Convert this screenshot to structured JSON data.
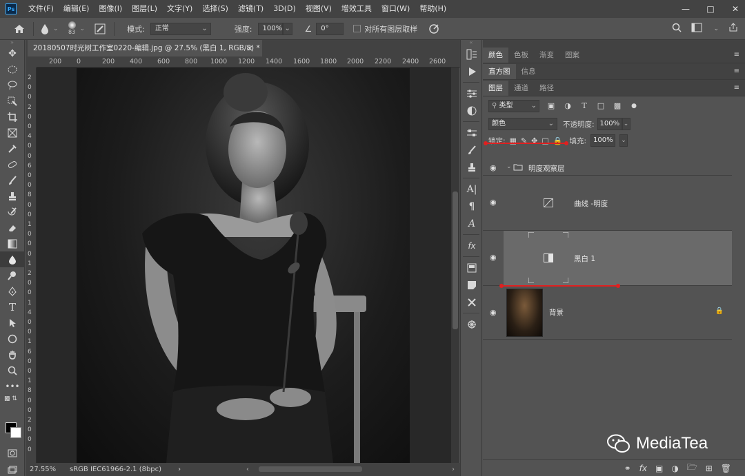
{
  "menubar": {
    "logo": "Ps",
    "items": [
      "文件(F)",
      "编辑(E)",
      "图像(I)",
      "图层(L)",
      "文字(Y)",
      "选择(S)",
      "滤镜(T)",
      "3D(D)",
      "视图(V)",
      "增效工具",
      "窗口(W)",
      "帮助(H)"
    ]
  },
  "options": {
    "brush_size": "83",
    "mode_label": "模式:",
    "mode_value": "正常",
    "strength_label": "强度:",
    "strength_value": "100%",
    "angle_value": "0°",
    "sample_all_label": "对所有图层取样"
  },
  "document": {
    "tab_title": "20180507时光树工作室0220-编辑.jpg @ 27.5% (黑白 1, RGB/8) *",
    "ruler_h": [
      "200",
      "0",
      "200",
      "400",
      "600",
      "800",
      "1000",
      "1200",
      "1400",
      "1600",
      "1800",
      "2000",
      "2200",
      "2400",
      "2600"
    ],
    "ruler_v": [
      "2",
      "0",
      "0",
      "2",
      "0",
      "0",
      "4",
      "0",
      "0",
      "6",
      "0",
      "0",
      "8",
      "0",
      "0",
      "1",
      "0",
      "0",
      "0",
      "1",
      "2",
      "0",
      "0",
      "1",
      "4",
      "0",
      "0",
      "1",
      "6",
      "0",
      "0",
      "1",
      "8",
      "0",
      "0",
      "2",
      "0",
      "0",
      "0"
    ],
    "zoom": "27.55%",
    "color_profile": "sRGB IEC61966-2.1 (8bpc)"
  },
  "panels": {
    "group1_tabs": [
      "颜色",
      "色板",
      "渐变",
      "图案"
    ],
    "group2_tabs": [
      "直方图",
      "信息"
    ],
    "group3_tabs": [
      "图层",
      "通道",
      "路径"
    ],
    "filter_kind": "类型",
    "blend_mode": "颜色",
    "opacity_label": "不透明度:",
    "opacity_value": "100%",
    "lock_label": "锁定:",
    "fill_label": "填充:",
    "fill_value": "100%",
    "layers": [
      {
        "name": "明度观察层",
        "type": "group"
      },
      {
        "name": "曲线 -明度",
        "type": "adjustment"
      },
      {
        "name": "黑白 1",
        "type": "adjustment",
        "selected": true
      },
      {
        "name": "背景",
        "type": "image",
        "locked": true
      }
    ]
  },
  "watermark": {
    "text": "MediaTea"
  },
  "colors": {
    "annotation_red": "#e02020",
    "selected_layer": "#6a6a6a",
    "panel_bg": "#535353"
  }
}
